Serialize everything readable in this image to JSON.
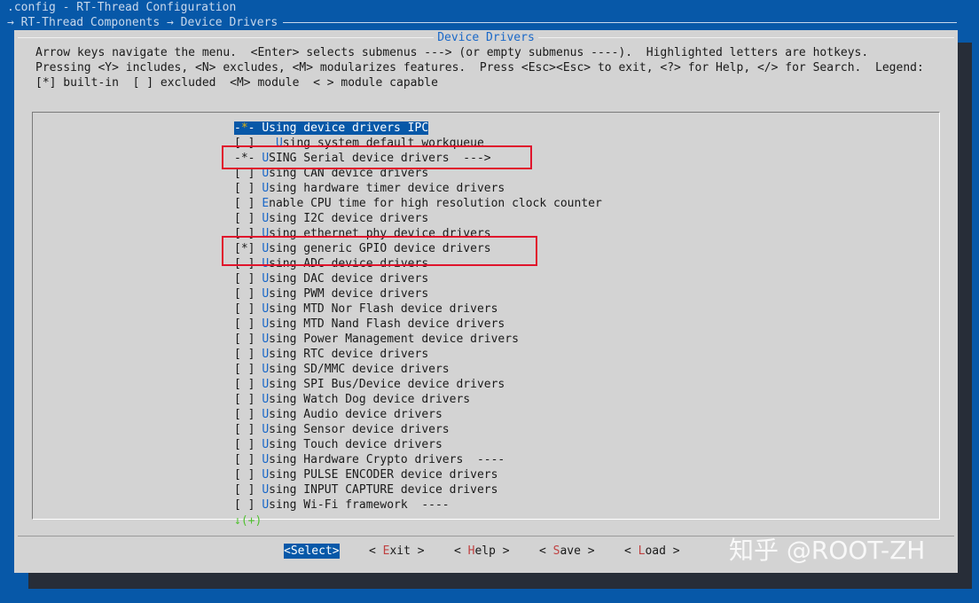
{
  "window": {
    "title": ".config - RT-Thread Configuration",
    "breadcrumb": "→ RT-Thread Components → Device Drivers"
  },
  "dialog": {
    "title": "Device Drivers",
    "help_lines": [
      "Arrow keys navigate the menu.  <Enter> selects submenus ---> (or empty submenus ----).  Highlighted letters are hotkeys.",
      "Pressing <Y> includes, <N> excludes, <M> modularizes features.  Press <Esc><Esc> to exit, <?> for Help, </> for Search.  Legend:",
      "[*] built-in  [ ] excluded  <M> module  < > module capable"
    ]
  },
  "menu": {
    "items": [
      {
        "marker": "-*-",
        "hotkey": "U",
        "rest": "sing device drivers IPC",
        "selected": true
      },
      {
        "marker": "[ ]",
        "indent": "  ",
        "hotkey": "U",
        "rest": "sing system default workqueue"
      },
      {
        "marker": "-*-",
        "hotkey": "U",
        "rest": "SING Serial device drivers  --->"
      },
      {
        "marker": "[ ]",
        "hotkey": "U",
        "rest": "sing CAN device drivers"
      },
      {
        "marker": "[ ]",
        "hotkey": "U",
        "rest": "sing hardware timer device drivers"
      },
      {
        "marker": "[ ]",
        "hotkey": "E",
        "rest": "nable CPU time for high resolution clock counter"
      },
      {
        "marker": "[ ]",
        "hotkey": "U",
        "rest": "sing I2C device drivers"
      },
      {
        "marker": "[ ]",
        "hotkey": "U",
        "rest": "sing ethernet phy device drivers"
      },
      {
        "marker": "[*]",
        "hotkey": "U",
        "rest": "sing generic GPIO device drivers"
      },
      {
        "marker": "[ ]",
        "hotkey": "U",
        "rest": "sing ADC device drivers"
      },
      {
        "marker": "[ ]",
        "hotkey": "U",
        "rest": "sing DAC device drivers"
      },
      {
        "marker": "[ ]",
        "hotkey": "U",
        "rest": "sing PWM device drivers"
      },
      {
        "marker": "[ ]",
        "hotkey": "U",
        "rest": "sing MTD Nor Flash device drivers"
      },
      {
        "marker": "[ ]",
        "hotkey": "U",
        "rest": "sing MTD Nand Flash device drivers"
      },
      {
        "marker": "[ ]",
        "hotkey": "U",
        "rest": "sing Power Management device drivers"
      },
      {
        "marker": "[ ]",
        "hotkey": "U",
        "rest": "sing RTC device drivers"
      },
      {
        "marker": "[ ]",
        "hotkey": "U",
        "rest": "sing SD/MMC device drivers"
      },
      {
        "marker": "[ ]",
        "hotkey": "U",
        "rest": "sing SPI Bus/Device device drivers"
      },
      {
        "marker": "[ ]",
        "hotkey": "U",
        "rest": "sing Watch Dog device drivers"
      },
      {
        "marker": "[ ]",
        "hotkey": "U",
        "rest": "sing Audio device drivers"
      },
      {
        "marker": "[ ]",
        "hotkey": "U",
        "rest": "sing Sensor device drivers"
      },
      {
        "marker": "[ ]",
        "hotkey": "U",
        "rest": "sing Touch device drivers"
      },
      {
        "marker": "[ ]",
        "hotkey": "U",
        "rest": "sing Hardware Crypto drivers  ----"
      },
      {
        "marker": "[ ]",
        "hotkey": "U",
        "rest": "sing PULSE ENCODER device drivers"
      },
      {
        "marker": "[ ]",
        "hotkey": "U",
        "rest": "sing INPUT CAPTURE device drivers"
      },
      {
        "marker": "[ ]",
        "hotkey": "U",
        "rest": "sing Wi-Fi framework  ----"
      }
    ],
    "more_indicator": "↓(+)"
  },
  "buttons": {
    "select": {
      "open": "<",
      "hotkey": "S",
      "rest": "elect",
      "close": ">"
    },
    "exit": {
      "open": "< ",
      "hotkey": "E",
      "rest": "xit",
      "close": " >"
    },
    "help": {
      "open": "< ",
      "hotkey": "H",
      "rest": "elp",
      "close": " >"
    },
    "save": {
      "open": "< ",
      "hotkey": "S",
      "rest": "ave",
      "close": " >"
    },
    "load": {
      "open": "< ",
      "hotkey": "L",
      "rest": "oad",
      "close": " >"
    }
  },
  "watermark": "知乎 @ROOT-ZH",
  "colors": {
    "background": "#0758a8",
    "dialog": "#d3d3d3",
    "hotkey": "#1a68c8",
    "button_hotkey": "#c04040",
    "annotation_box": "#e0142c"
  }
}
